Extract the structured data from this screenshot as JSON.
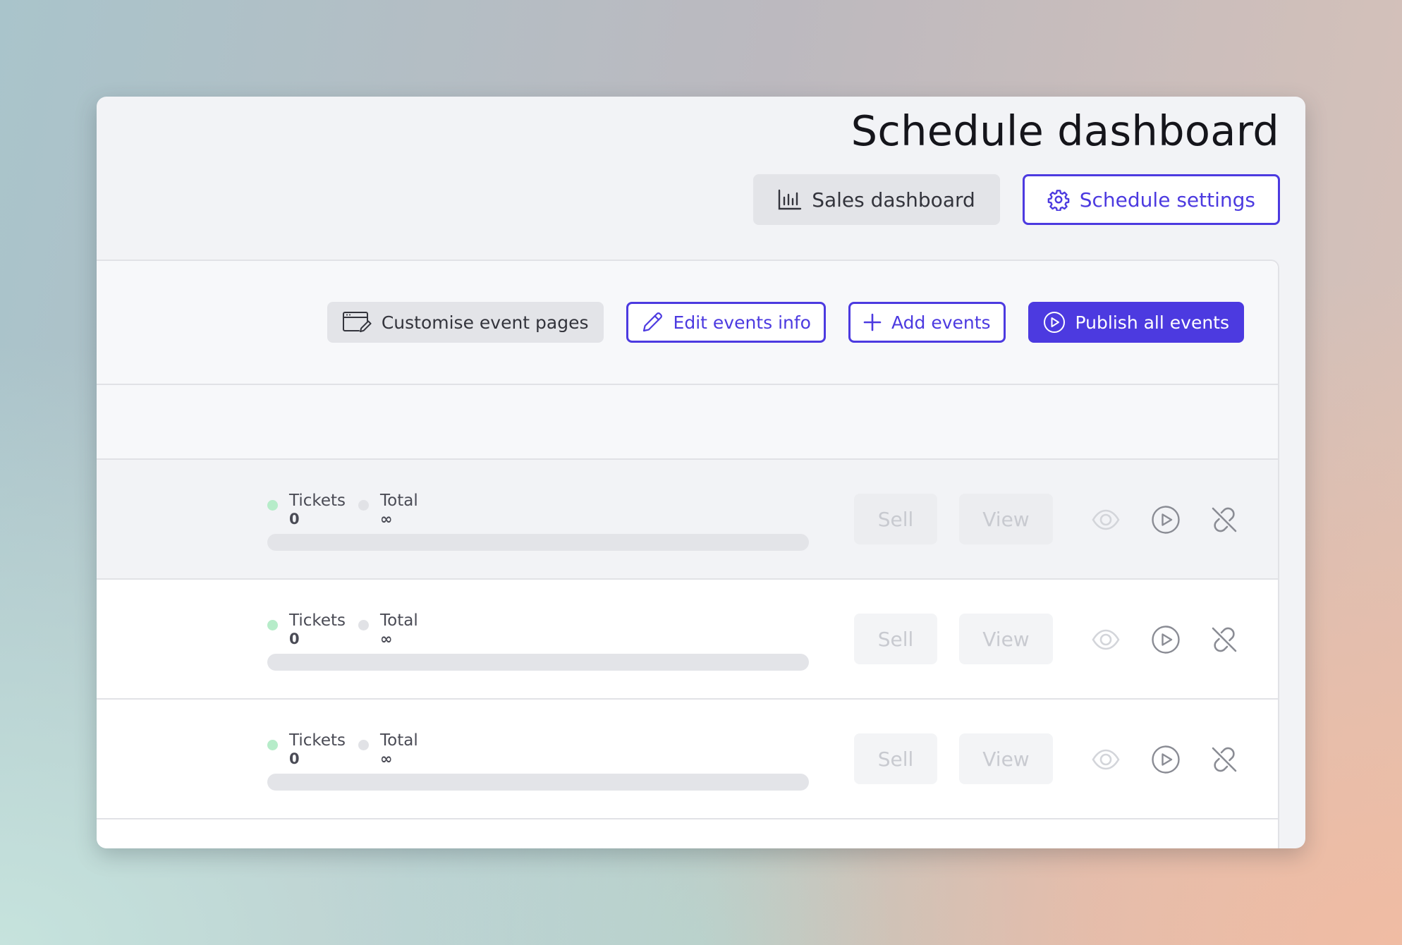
{
  "header": {
    "title": "Schedule dashboard",
    "sales_dashboard_label": "Sales dashboard",
    "schedule_settings_label": "Schedule settings"
  },
  "toolbar": {
    "customise_label": "Customise event pages",
    "edit_label": "Edit events info",
    "add_label": "Add events",
    "publish_label": "Publish all events"
  },
  "events": [
    {
      "tickets_label": "Tickets",
      "tickets_value": "0",
      "total_label": "Total",
      "total_value": "∞",
      "progress": 0,
      "sell_label": "Sell",
      "view_label": "View"
    },
    {
      "tickets_label": "Tickets",
      "tickets_value": "0",
      "total_label": "Total",
      "total_value": "∞",
      "progress": 0,
      "sell_label": "Sell",
      "view_label": "View"
    },
    {
      "tickets_label": "Tickets",
      "tickets_value": "0",
      "total_label": "Total",
      "total_value": "∞",
      "progress": 0,
      "sell_label": "Sell",
      "view_label": "View"
    }
  ],
  "icons": {
    "sales": "bar-chart-icon",
    "settings": "gear-icon",
    "customise": "browser-edit-icon",
    "edit": "pencil-icon",
    "add": "plus-icon",
    "publish": "play-circle-icon",
    "row_visibility": "eye-icon",
    "row_publish": "play-circle-icon",
    "row_unlink": "unlink-icon"
  },
  "colors": {
    "accent": "#4c3ae0",
    "tickets_dot": "#b6ecc9",
    "total_dot": "#e1e2e6",
    "disabled_text": "#c8cad0",
    "row_icon": "#8a8c94",
    "eye_icon": "#d3d5da"
  }
}
